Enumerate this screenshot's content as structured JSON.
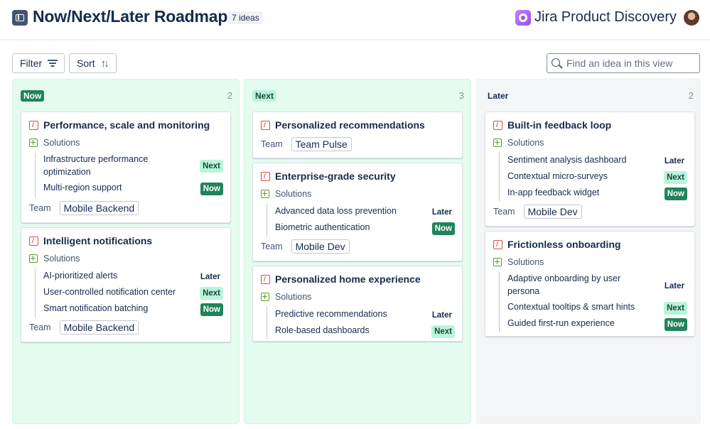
{
  "header": {
    "title": "Now/Next/Later Roadmap",
    "idea_count": "7 ideas",
    "brand": "Jira Product Discovery"
  },
  "toolbar": {
    "filter_label": "Filter",
    "sort_label": "Sort",
    "sort_glyph": "↑↓",
    "search_placeholder": "Find an idea in this view"
  },
  "columns": [
    {
      "label": "Now",
      "count": "2",
      "cards": [
        {
          "title": "Performance, scale and monitoring",
          "solutions_label": "Solutions",
          "solutions": [
            {
              "text": "Infrastructure performance optimization",
              "status": "Next"
            },
            {
              "text": "Multi-region support",
              "status": "Now"
            }
          ],
          "team_label": "Team",
          "team": "Mobile Backend"
        },
        {
          "title": "Intelligent notifications",
          "solutions_label": "Solutions",
          "solutions": [
            {
              "text": "AI-prioritized alerts",
              "status": "Later"
            },
            {
              "text": "User-controlled notification center",
              "status": "Next"
            },
            {
              "text": "Smart notification batching",
              "status": "Now"
            }
          ],
          "team_label": "Team",
          "team": "Mobile Backend"
        }
      ]
    },
    {
      "label": "Next",
      "count": "3",
      "cards": [
        {
          "title": "Personalized recommendations",
          "team_label": "Team",
          "team": "Team Pulse"
        },
        {
          "title": "Enterprise-grade security",
          "solutions_label": "Solutions",
          "solutions": [
            {
              "text": "Advanced data loss prevention",
              "status": "Later"
            },
            {
              "text": "Biometric authentication",
              "status": "Now"
            }
          ],
          "team_label": "Team",
          "team": "Mobile Dev"
        },
        {
          "title": "Personalized home experience",
          "solutions_label": "Solutions",
          "solutions": [
            {
              "text": "Predictive recommendations",
              "status": "Later"
            },
            {
              "text": "Role-based dashboards",
              "status": "Next"
            }
          ]
        }
      ]
    },
    {
      "label": "Later",
      "count": "2",
      "cards": [
        {
          "title": "Built-in feedback loop",
          "solutions_label": "Solutions",
          "solutions": [
            {
              "text": "Sentiment analysis dashboard",
              "status": "Later"
            },
            {
              "text": "Contextual micro-surveys",
              "status": "Next"
            },
            {
              "text": "In-app feedback widget",
              "status": "Now"
            }
          ],
          "team_label": "Team",
          "team": "Mobile Dev"
        },
        {
          "title": "Frictionless onboarding",
          "solutions_label": "Solutions",
          "solutions": [
            {
              "text": "Adaptive onboarding by user persona",
              "status": "Later"
            },
            {
              "text": "Contextual tooltips & smart hints",
              "status": "Next"
            },
            {
              "text": "Guided first-run experience",
              "status": "Now"
            }
          ]
        }
      ]
    }
  ],
  "colors": {
    "now_bg": "#1f845a",
    "next_bg": "#baf3db",
    "column_now_next": "#e3fcef",
    "column_later": "#f4f5f7",
    "idea_icon": "#e2483d",
    "solution_icon": "#5b9b2f"
  }
}
